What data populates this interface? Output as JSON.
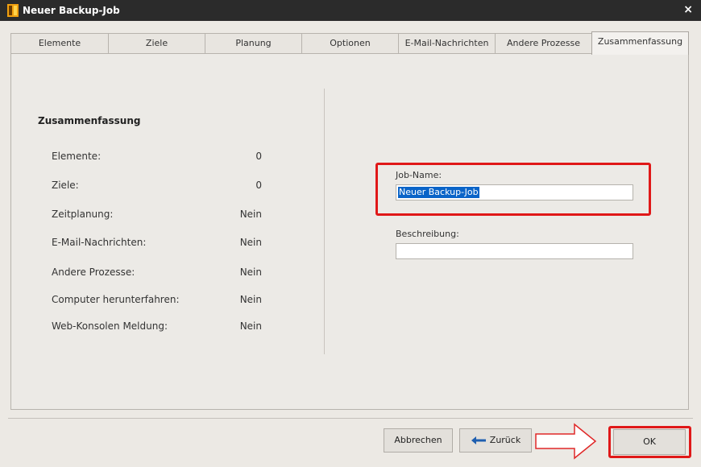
{
  "window": {
    "title": "Neuer Backup-Job",
    "close_glyph": "×"
  },
  "tabs": [
    {
      "label": "Elemente"
    },
    {
      "label": "Ziele"
    },
    {
      "label": "Planung"
    },
    {
      "label": "Optionen"
    },
    {
      "label": "E-Mail-Nachrichten"
    },
    {
      "label": "Andere Prozesse"
    },
    {
      "label": "Zusammenfassung",
      "active": true
    }
  ],
  "summary": {
    "title": "Zusammenfassung",
    "rows": [
      {
        "label": "Elemente:",
        "value": "0"
      },
      {
        "label": "Ziele:",
        "value": "0"
      },
      {
        "label": "Zeitplanung:",
        "value": "Nein"
      },
      {
        "label": "E-Mail-Nachrichten:",
        "value": "Nein"
      },
      {
        "label": "Andere Prozesse:",
        "value": "Nein"
      },
      {
        "label": "Computer herunterfahren:",
        "value": "Nein"
      },
      {
        "label": "Web-Konsolen Meldung:",
        "value": "Nein"
      }
    ]
  },
  "form": {
    "job_name_label": "Job-Name:",
    "job_name_value": "Neuer Backup-Job",
    "description_label": "Beschreibung:",
    "description_value": ""
  },
  "buttons": {
    "cancel": "Abbrechen",
    "back": "Zurück",
    "ok": "OK"
  },
  "colors": {
    "highlight": "#e01818",
    "selection": "#0a64c8",
    "titlebar": "#2b2b2b"
  },
  "icons": {
    "app": "backup-app-icon",
    "back": "arrow-left-icon",
    "pointer": "arrow-right-outline-icon"
  }
}
